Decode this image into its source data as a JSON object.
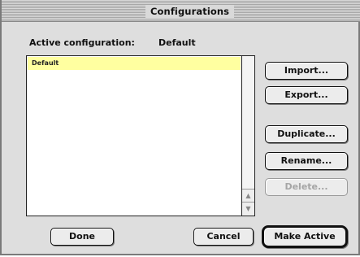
{
  "dialog": {
    "title": "Configurations",
    "active_label": "Active configuration:",
    "active_value": "Default"
  },
  "list": {
    "items": [
      "Default"
    ],
    "selected": "Default"
  },
  "buttons": {
    "import": "Import...",
    "export": "Export...",
    "duplicate": "Duplicate...",
    "rename": "Rename...",
    "delete": "Delete...",
    "done": "Done",
    "cancel": "Cancel",
    "make_active": "Make Active"
  },
  "icons": {
    "scroll_up": "up-arrow-icon",
    "scroll_down": "down-arrow-icon"
  },
  "colors": {
    "selection": "#ffffa0",
    "dialog_bg": "#dedede"
  }
}
